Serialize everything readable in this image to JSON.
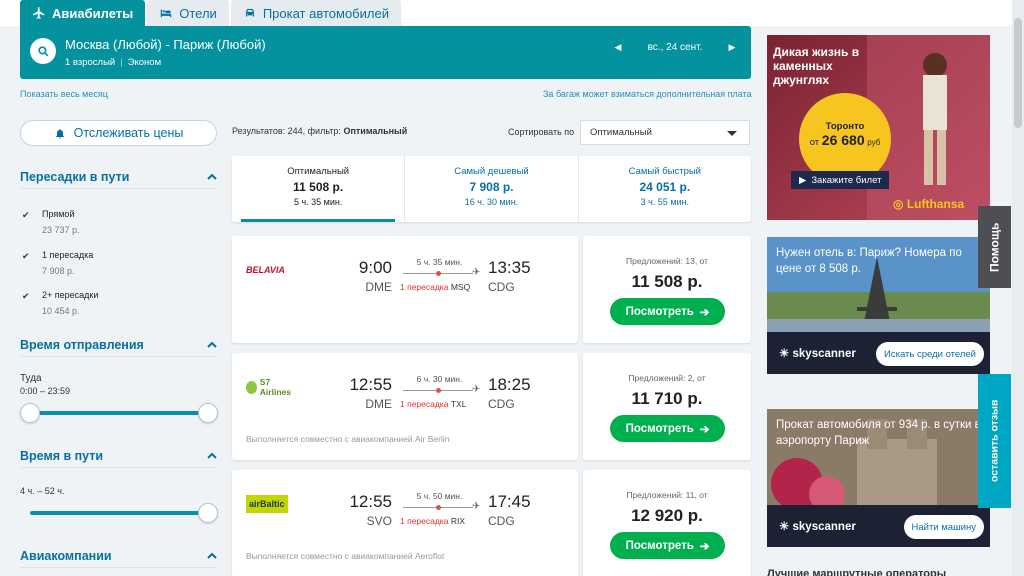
{
  "nav": {
    "tabs": [
      {
        "label": "Авиабилеты",
        "icon": "plane-icon"
      },
      {
        "label": "Отели",
        "icon": "bed-icon"
      },
      {
        "label": "Прокат автомобилей",
        "icon": "car-icon"
      }
    ]
  },
  "search": {
    "route": "Москва (Любой) - Париж (Любой)",
    "passengers": "1 взрослый",
    "cabin": "Эконом",
    "date": "вс., 24 сент."
  },
  "links": {
    "show_month": "Показать весь месяц",
    "baggage": "За багаж может взиматься дополнительная плата"
  },
  "filters": {
    "track_prices": "Отслеживать цены",
    "stops_title": "Пересадки в пути",
    "stops": [
      {
        "label": "Прямой",
        "price": "23 737 р."
      },
      {
        "label": "1 пересадка",
        "price": "7 908 р."
      },
      {
        "label": "2+ пересадки",
        "price": "10 454 р."
      }
    ],
    "departure_title": "Время отправления",
    "departure_dir": "Туда",
    "departure_range": "0:00 – 23:59",
    "duration_title": "Время в пути",
    "duration_range": "4 ч. – 52 ч.",
    "airlines_title": "Авиакомпании"
  },
  "results": {
    "count_label": "Результатов: 244, фильтр:",
    "filter_value": "Оптимальный",
    "sort_label": "Сортировать по",
    "sort_value": "Оптимальный"
  },
  "summary": [
    {
      "title": "Оптимальный",
      "price": "11 508 р.",
      "duration": "5 ч. 35 мин."
    },
    {
      "title": "Самый дешевый",
      "price": "7 908 р.",
      "duration": "16 ч. 30 мин."
    },
    {
      "title": "Самый быстрый",
      "price": "24 051 р.",
      "duration": "3 ч. 55 мин."
    }
  ],
  "flights": [
    {
      "airline": "BELAVIA",
      "dep_time": "9:00",
      "dep_code": "DME",
      "arr_time": "13:35",
      "arr_code": "CDG",
      "duration": "5 ч. 35 мин.",
      "stops": "1 пересадка",
      "via": "MSQ",
      "operated": "",
      "offers": "Предложений: 13, от",
      "price": "11 508 р.",
      "button": "Посмотреть"
    },
    {
      "airline": "S7 Airlines",
      "dep_time": "12:55",
      "dep_code": "DME",
      "arr_time": "18:25",
      "arr_code": "CDG",
      "duration": "6 ч. 30 мин.",
      "stops": "1 пересадка",
      "via": "TXL",
      "operated": "Выполняется совместно с авиакомпанией Air Berlin",
      "offers": "Предложений: 2, от",
      "price": "11 710 р.",
      "button": "Посмотреть"
    },
    {
      "airline": "airBaltic",
      "dep_time": "12:55",
      "dep_code": "SVO",
      "arr_time": "17:45",
      "arr_code": "CDG",
      "duration": "5 ч. 50 мин.",
      "stops": "1 пересадка",
      "via": "RIX",
      "operated": "Выполняется совместно с авиакомпанией Aeroflot",
      "offers": "Предложений: 11, от",
      "price": "12 920 р.",
      "button": "Посмотреть"
    }
  ],
  "ads": {
    "lufthansa": {
      "headline": "Дикая жизнь в каменных джунглях",
      "city": "Торонто",
      "price_prefix": "от",
      "price": "26 680",
      "price_suffix": "руб",
      "button": "Закажите билет",
      "brand": "Lufthansa"
    },
    "hotel": {
      "headline": "Нужен отель в: Париж? Номера по цене от 8 508 р.",
      "brand": "skyscanner",
      "button": "Искать среди отелей"
    },
    "car": {
      "headline": "Прокат автомобиля от 934 р. в сутки в аэропорту Париж",
      "brand": "skyscanner",
      "button": "Найти машину"
    }
  },
  "side": {
    "help": "Помощь",
    "feedback": "оставить отзыв"
  },
  "bottom_heading": "Лучшие маршрутные операторы"
}
